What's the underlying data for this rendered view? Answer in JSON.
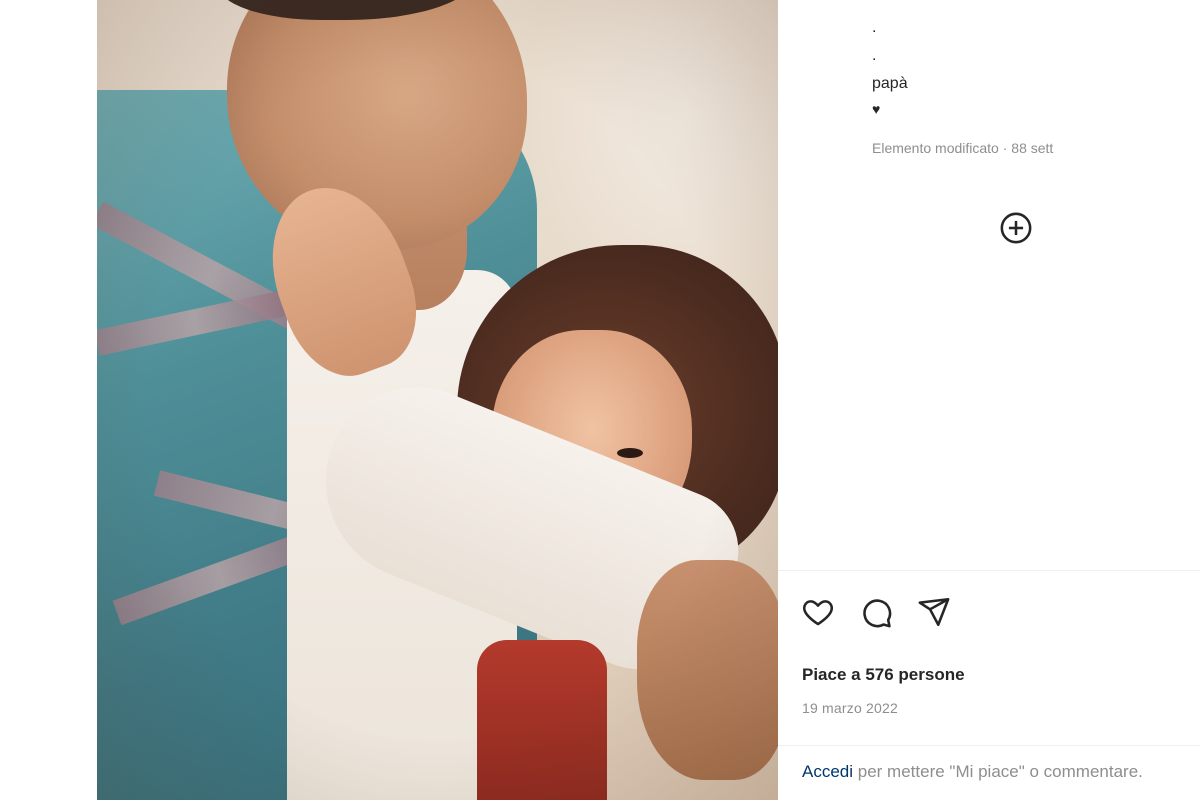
{
  "post": {
    "caption_lines": [
      ".",
      ".",
      "papà",
      "♥"
    ],
    "edited_label": "Elemento modificato · 88 sett"
  },
  "actions": {
    "like_icon": "heart-icon",
    "comment_icon": "comment-icon",
    "share_icon": "send-icon",
    "add_icon": "plus-circle-icon"
  },
  "stats": {
    "likes_text": "Piace a 576 persone",
    "date": "19 marzo 2022"
  },
  "login_prompt": {
    "link_label": "Accedi",
    "text": " per mettere \"Mi piace\" o commentare."
  },
  "colors": {
    "text": "#262626",
    "muted": "#8e8e8e",
    "link": "#00376b"
  }
}
